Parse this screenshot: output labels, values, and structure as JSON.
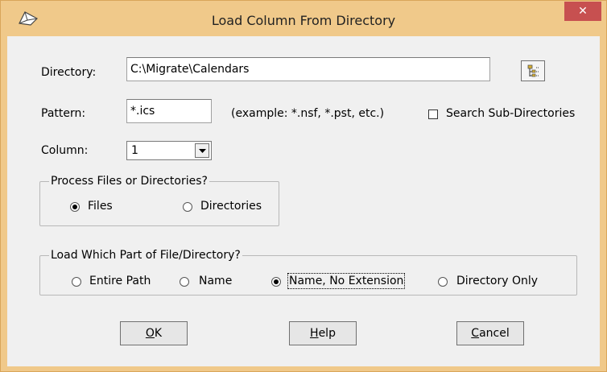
{
  "window": {
    "title": "Load Column From Directory",
    "close_glyph": "✕"
  },
  "directory": {
    "label": "Directory:",
    "value": "C:\\Migrate\\Calendars",
    "browse_icon": "folder-tree-icon"
  },
  "pattern": {
    "label": "Pattern:",
    "value": "*.ics",
    "example": "(example: *.nsf, *.pst, etc.)",
    "search_subdirs_label": "Search Sub-Directories",
    "search_subdirs_checked": false
  },
  "column": {
    "label": "Column:",
    "value": "1"
  },
  "process_group": {
    "legend": "Process Files or Directories?",
    "options": [
      {
        "label": "Files",
        "checked": true
      },
      {
        "label": "Directories",
        "checked": false
      }
    ]
  },
  "load_group": {
    "legend": "Load Which Part of File/Directory?",
    "options": [
      {
        "label": "Entire Path",
        "checked": false
      },
      {
        "label": "Name",
        "checked": false
      },
      {
        "label": "Name, No Extension",
        "checked": true
      },
      {
        "label": "Directory Only",
        "checked": false
      }
    ]
  },
  "buttons": {
    "ok": {
      "accel": "O",
      "rest": "K"
    },
    "help": {
      "accel": "H",
      "rest": "elp"
    },
    "cancel": {
      "accel": "C",
      "rest": "ancel"
    }
  },
  "colors": {
    "titlebar": "#f0c98a",
    "close": "#c75050",
    "dialog_bg": "#f0f0f0"
  }
}
